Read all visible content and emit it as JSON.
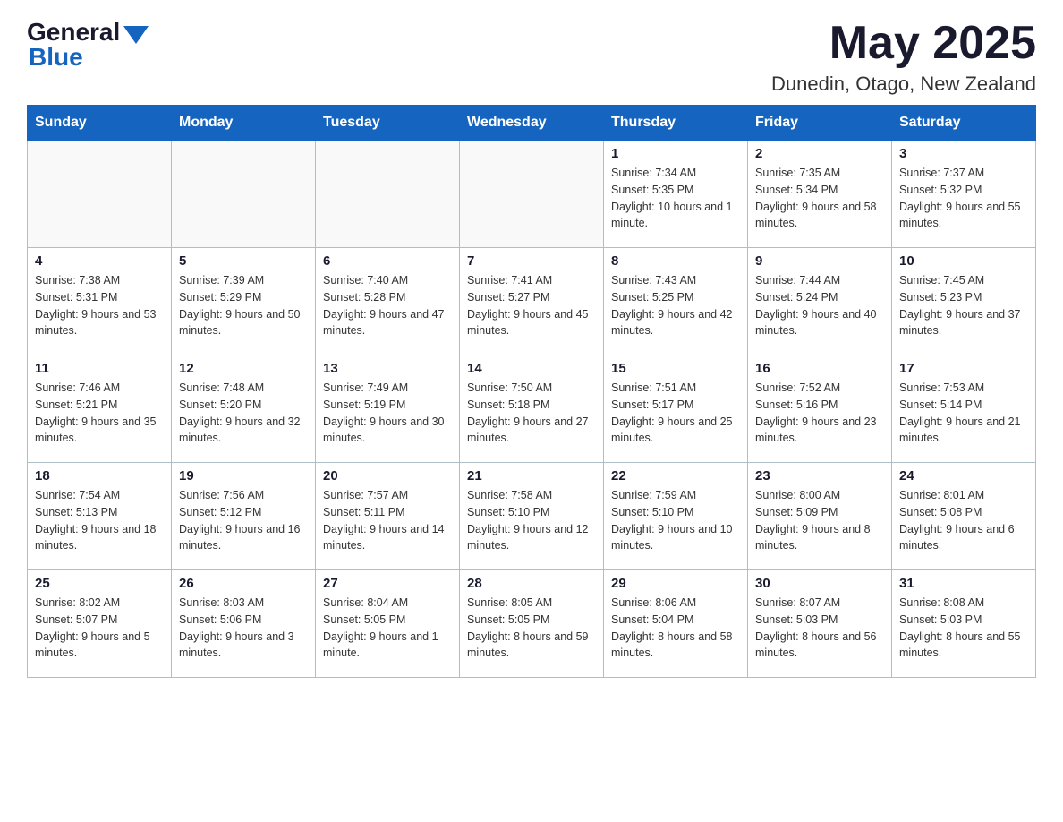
{
  "header": {
    "logo_general": "General",
    "logo_blue": "Blue",
    "month_year": "May 2025",
    "location": "Dunedin, Otago, New Zealand"
  },
  "days_of_week": [
    "Sunday",
    "Monday",
    "Tuesday",
    "Wednesday",
    "Thursday",
    "Friday",
    "Saturday"
  ],
  "weeks": [
    [
      {
        "day": "",
        "info": ""
      },
      {
        "day": "",
        "info": ""
      },
      {
        "day": "",
        "info": ""
      },
      {
        "day": "",
        "info": ""
      },
      {
        "day": "1",
        "info": "Sunrise: 7:34 AM\nSunset: 5:35 PM\nDaylight: 10 hours and 1 minute."
      },
      {
        "day": "2",
        "info": "Sunrise: 7:35 AM\nSunset: 5:34 PM\nDaylight: 9 hours and 58 minutes."
      },
      {
        "day": "3",
        "info": "Sunrise: 7:37 AM\nSunset: 5:32 PM\nDaylight: 9 hours and 55 minutes."
      }
    ],
    [
      {
        "day": "4",
        "info": "Sunrise: 7:38 AM\nSunset: 5:31 PM\nDaylight: 9 hours and 53 minutes."
      },
      {
        "day": "5",
        "info": "Sunrise: 7:39 AM\nSunset: 5:29 PM\nDaylight: 9 hours and 50 minutes."
      },
      {
        "day": "6",
        "info": "Sunrise: 7:40 AM\nSunset: 5:28 PM\nDaylight: 9 hours and 47 minutes."
      },
      {
        "day": "7",
        "info": "Sunrise: 7:41 AM\nSunset: 5:27 PM\nDaylight: 9 hours and 45 minutes."
      },
      {
        "day": "8",
        "info": "Sunrise: 7:43 AM\nSunset: 5:25 PM\nDaylight: 9 hours and 42 minutes."
      },
      {
        "day": "9",
        "info": "Sunrise: 7:44 AM\nSunset: 5:24 PM\nDaylight: 9 hours and 40 minutes."
      },
      {
        "day": "10",
        "info": "Sunrise: 7:45 AM\nSunset: 5:23 PM\nDaylight: 9 hours and 37 minutes."
      }
    ],
    [
      {
        "day": "11",
        "info": "Sunrise: 7:46 AM\nSunset: 5:21 PM\nDaylight: 9 hours and 35 minutes."
      },
      {
        "day": "12",
        "info": "Sunrise: 7:48 AM\nSunset: 5:20 PM\nDaylight: 9 hours and 32 minutes."
      },
      {
        "day": "13",
        "info": "Sunrise: 7:49 AM\nSunset: 5:19 PM\nDaylight: 9 hours and 30 minutes."
      },
      {
        "day": "14",
        "info": "Sunrise: 7:50 AM\nSunset: 5:18 PM\nDaylight: 9 hours and 27 minutes."
      },
      {
        "day": "15",
        "info": "Sunrise: 7:51 AM\nSunset: 5:17 PM\nDaylight: 9 hours and 25 minutes."
      },
      {
        "day": "16",
        "info": "Sunrise: 7:52 AM\nSunset: 5:16 PM\nDaylight: 9 hours and 23 minutes."
      },
      {
        "day": "17",
        "info": "Sunrise: 7:53 AM\nSunset: 5:14 PM\nDaylight: 9 hours and 21 minutes."
      }
    ],
    [
      {
        "day": "18",
        "info": "Sunrise: 7:54 AM\nSunset: 5:13 PM\nDaylight: 9 hours and 18 minutes."
      },
      {
        "day": "19",
        "info": "Sunrise: 7:56 AM\nSunset: 5:12 PM\nDaylight: 9 hours and 16 minutes."
      },
      {
        "day": "20",
        "info": "Sunrise: 7:57 AM\nSunset: 5:11 PM\nDaylight: 9 hours and 14 minutes."
      },
      {
        "day": "21",
        "info": "Sunrise: 7:58 AM\nSunset: 5:10 PM\nDaylight: 9 hours and 12 minutes."
      },
      {
        "day": "22",
        "info": "Sunrise: 7:59 AM\nSunset: 5:10 PM\nDaylight: 9 hours and 10 minutes."
      },
      {
        "day": "23",
        "info": "Sunrise: 8:00 AM\nSunset: 5:09 PM\nDaylight: 9 hours and 8 minutes."
      },
      {
        "day": "24",
        "info": "Sunrise: 8:01 AM\nSunset: 5:08 PM\nDaylight: 9 hours and 6 minutes."
      }
    ],
    [
      {
        "day": "25",
        "info": "Sunrise: 8:02 AM\nSunset: 5:07 PM\nDaylight: 9 hours and 5 minutes."
      },
      {
        "day": "26",
        "info": "Sunrise: 8:03 AM\nSunset: 5:06 PM\nDaylight: 9 hours and 3 minutes."
      },
      {
        "day": "27",
        "info": "Sunrise: 8:04 AM\nSunset: 5:05 PM\nDaylight: 9 hours and 1 minute."
      },
      {
        "day": "28",
        "info": "Sunrise: 8:05 AM\nSunset: 5:05 PM\nDaylight: 8 hours and 59 minutes."
      },
      {
        "day": "29",
        "info": "Sunrise: 8:06 AM\nSunset: 5:04 PM\nDaylight: 8 hours and 58 minutes."
      },
      {
        "day": "30",
        "info": "Sunrise: 8:07 AM\nSunset: 5:03 PM\nDaylight: 8 hours and 56 minutes."
      },
      {
        "day": "31",
        "info": "Sunrise: 8:08 AM\nSunset: 5:03 PM\nDaylight: 8 hours and 55 minutes."
      }
    ]
  ]
}
